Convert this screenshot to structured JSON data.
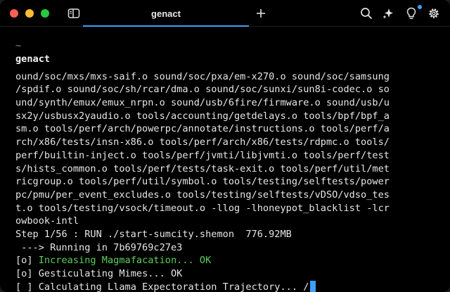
{
  "titlebar": {
    "tab_title": "genact",
    "icons": {
      "split": "sidebar-split-icon",
      "new_tab": "plus-icon",
      "search": "search-icon",
      "ai": "sparkle-icon",
      "tips": "lightbulb-icon",
      "settings": "gear-icon"
    },
    "accent_color": "#3fa0ff"
  },
  "terminal": {
    "cwd": "~",
    "command": "genact",
    "output_lines": [
      "ound/soc/mxs/mxs-saif.o sound/soc/pxa/em-x270.o sound/soc/samsung",
      "/spdif.o sound/soc/sh/rcar/dma.o sound/soc/sunxi/sun8i-codec.o so",
      "und/synth/emux/emux_nrpn.o sound/usb/6fire/firmware.o sound/usb/u",
      "sx2y/usbusx2yaudio.o tools/accounting/getdelays.o tools/bpf/bpf_a",
      "sm.o tools/perf/arch/powerpc/annotate/instructions.o tools/perf/a",
      "rch/x86/tests/insn-x86.o tools/perf/arch/x86/tests/rdpmc.o tools/",
      "perf/builtin-inject.o tools/perf/jvmti/libjvmti.o tools/perf/test",
      "s/hists_common.o tools/perf/tests/task-exit.o tools/perf/util/met",
      "ricgroup.o tools/perf/util/symbol.o tools/testing/selftests/power",
      "pc/pmu/per_event_excludes.o tools/testing/selftests/vDSO/vdso_tes",
      "t.o tools/testing/vsock/timeout.o -llog -lhoneypot_blacklist -lcr",
      "owbook-intl",
      "Step 1/56 : RUN ./start-sumcity.shemon  776.92MB",
      " ---> Running in 7b69769c27e3"
    ],
    "status_lines": [
      {
        "prefix": "[o] ",
        "text": "Increasing Magmafacation... OK",
        "color": "#5bd15b"
      },
      {
        "prefix": "[o] ",
        "text": "Gesticulating Mimes... OK",
        "color": "#e6e6e6"
      },
      {
        "prefix": "[ ] ",
        "text": "Calculating Llama Expectoration Trajectory... /",
        "color": "#e6e6e6"
      }
    ]
  }
}
